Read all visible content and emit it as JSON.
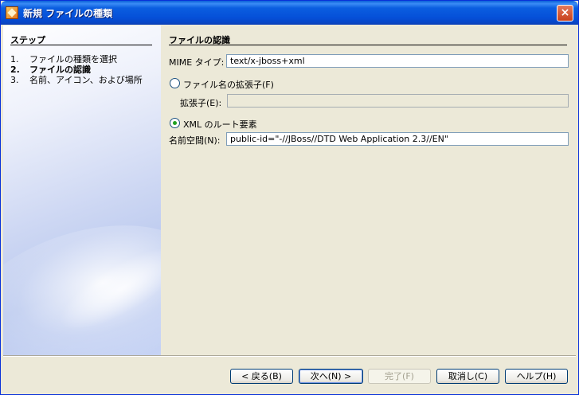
{
  "window": {
    "title": "新規 ファイルの種類",
    "close_icon": "×"
  },
  "steps": {
    "header": "ステップ",
    "items": [
      {
        "num": "1.",
        "label": "ファイルの種類を選択"
      },
      {
        "num": "2.",
        "label": "ファイルの認識"
      },
      {
        "num": "3.",
        "label": "名前、アイコン、および場所"
      }
    ]
  },
  "main": {
    "section_title": "ファイルの認識",
    "mime": {
      "label": "MIME タイプ:",
      "value": "text/x-jboss+xml"
    },
    "ext_radio": {
      "label": "ファイル名の拡張子(F)"
    },
    "ext_field": {
      "label": "拡張子(E):",
      "value": ""
    },
    "xml_radio": {
      "label": "XML のルート要素"
    },
    "namespace": {
      "label": "名前空間(N):",
      "value": "public-id=\"-//JBoss//DTD Web Application 2.3//EN\""
    }
  },
  "buttons": {
    "back": "< 戻る(B)",
    "next": "次へ(N) >",
    "finish": "完了(F)",
    "cancel": "取消し(C)",
    "help": "ヘルプ(H)"
  }
}
